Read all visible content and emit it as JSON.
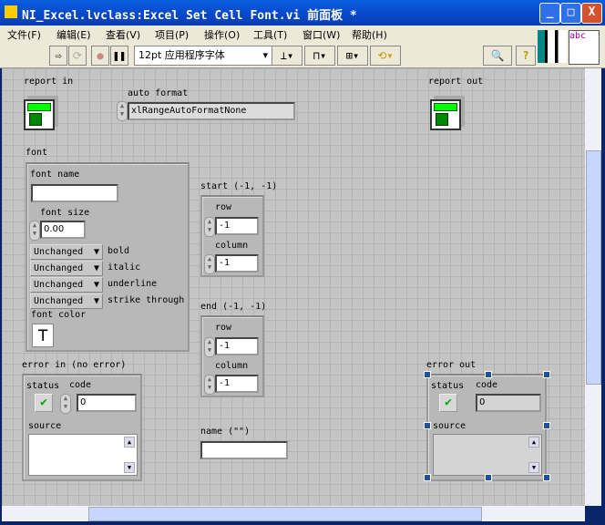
{
  "window": {
    "title": "NI_Excel.lvclass:Excel Set Cell Font.vi 前面板 *",
    "minimize": "_",
    "maximize": "□",
    "close": "X"
  },
  "menu": [
    "文件(F)",
    "编辑(E)",
    "查看(V)",
    "项目(P)",
    "操作(O)",
    "工具(T)",
    "窗口(W)",
    "帮助(H)"
  ],
  "toolbar": {
    "font": "12pt 应用程序字体",
    "palette_label": "abc"
  },
  "panel": {
    "report_in": "report in",
    "report_out": "report out",
    "auto_format": {
      "label": "auto format",
      "value": "xlRangeAutoFormatNone"
    },
    "font": {
      "label": "font",
      "font_name": "font name",
      "font_name_value": "",
      "font_size": "font size",
      "font_size_value": "0.00",
      "rings": [
        {
          "value": "Unchanged",
          "label": "bold"
        },
        {
          "value": "Unchanged",
          "label": "italic"
        },
        {
          "value": "Unchanged",
          "label": "underline"
        },
        {
          "value": "Unchanged",
          "label": "strike through"
        }
      ],
      "font_color": "font color"
    },
    "start": {
      "label": "start (-1, -1)",
      "row": "row",
      "row_value": "-1",
      "column": "column",
      "column_value": "-1"
    },
    "end": {
      "label": "end (-1, -1)",
      "row": "row",
      "row_value": "-1",
      "column": "column",
      "column_value": "-1"
    },
    "name": {
      "label": "name (\"\")",
      "value": ""
    },
    "error_in": {
      "label": "error in (no error)",
      "status": "status",
      "code": "code",
      "code_value": "0",
      "source": "source"
    },
    "error_out": {
      "label": "error out",
      "status": "status",
      "code": "code",
      "code_value": "0",
      "source": "source"
    }
  }
}
